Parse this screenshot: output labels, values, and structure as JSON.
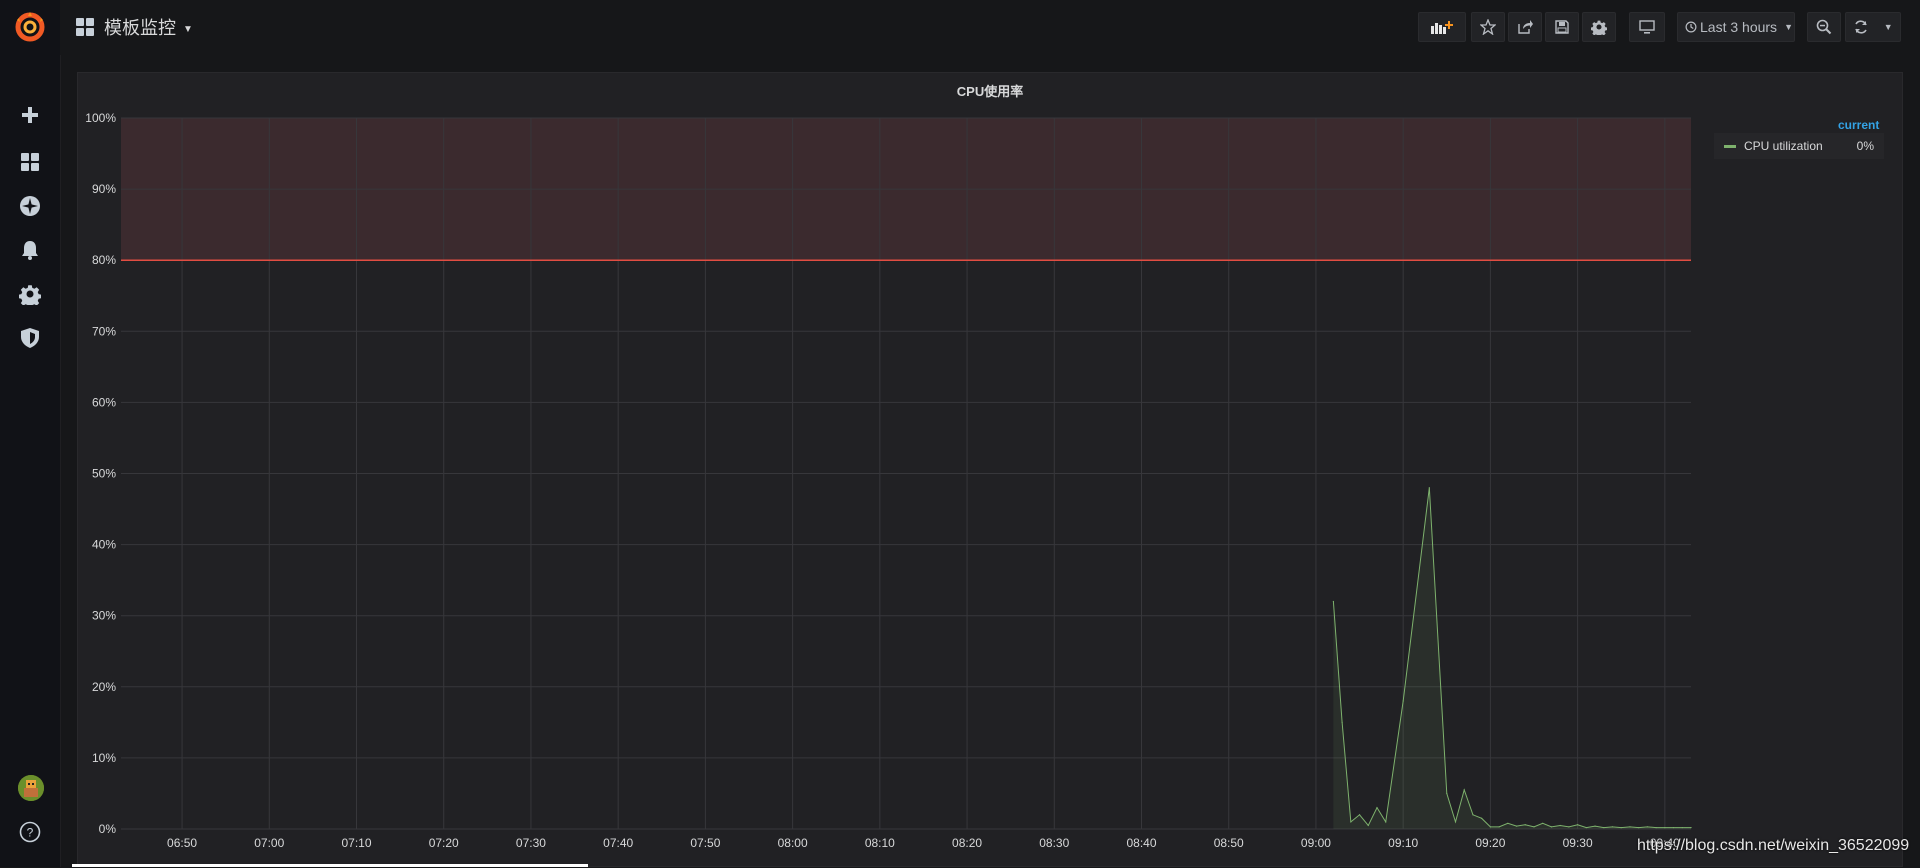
{
  "topbar": {
    "dashboard_name": "模板监控",
    "time_range": "Last 3 hours"
  },
  "panel": {
    "title": "CPU使用率",
    "legend_header": "current",
    "legend_items": [
      {
        "label": "CPU utilization",
        "value": "0%",
        "color": "#7eb26d"
      }
    ]
  },
  "watermark": "https://blog.csdn.net/weixin_36522099",
  "colors": {
    "series": "#7eb26d",
    "threshold": "#e24d42",
    "threshold_fill": "#3b2a2e",
    "legend_header": "#33a2e5"
  },
  "chart_data": {
    "type": "line",
    "title": "CPU使用率",
    "xlabel": "",
    "ylabel": "",
    "x_ticks": [
      "06:50",
      "07:00",
      "07:10",
      "07:20",
      "07:30",
      "07:40",
      "07:50",
      "08:00",
      "08:10",
      "08:20",
      "08:30",
      "08:40",
      "08:50",
      "09:00",
      "09:10",
      "09:20",
      "09:30",
      "09:40"
    ],
    "y_ticks": [
      "0%",
      "10%",
      "20%",
      "30%",
      "40%",
      "50%",
      "60%",
      "70%",
      "80%",
      "90%",
      "100%"
    ],
    "ylim": [
      0,
      100
    ],
    "xlim": [
      "06:43",
      "09:43"
    ],
    "grid": true,
    "legend_position": "right",
    "threshold": {
      "value": 80,
      "fill": "above"
    },
    "series": [
      {
        "name": "CPU utilization",
        "x": [
          "09:02",
          "09:03",
          "09:04",
          "09:05",
          "09:06",
          "09:07",
          "09:08",
          "09:10",
          "09:13",
          "09:15",
          "09:16",
          "09:17",
          "09:18",
          "09:19",
          "09:20",
          "09:21",
          "09:22",
          "09:23",
          "09:24",
          "09:25",
          "09:26",
          "09:27",
          "09:28",
          "09:29",
          "09:30",
          "09:31",
          "09:32",
          "09:33",
          "09:34",
          "09:35",
          "09:36",
          "09:37",
          "09:38",
          "09:39",
          "09:40",
          "09:41",
          "09:42",
          "09:43"
        ],
        "values": [
          32,
          15,
          1,
          2,
          0.5,
          3,
          1,
          18,
          48,
          5,
          1,
          5.5,
          2,
          1.5,
          0.3,
          0.3,
          0.8,
          0.4,
          0.6,
          0.3,
          0.8,
          0.3,
          0.5,
          0.3,
          0.6,
          0.2,
          0.4,
          0.2,
          0.3,
          0.2,
          0.3,
          0.2,
          0.3,
          0.2,
          0.2,
          0.2,
          0.2,
          0.2
        ]
      }
    ]
  }
}
